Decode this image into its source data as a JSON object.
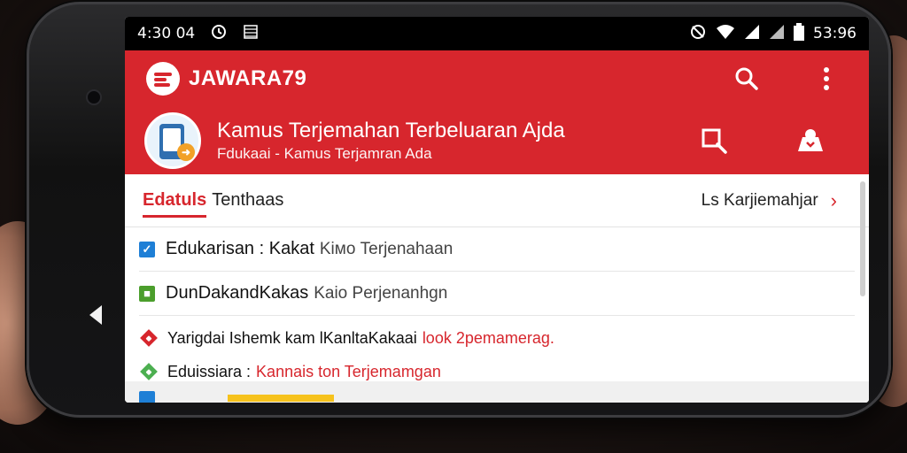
{
  "status_bar": {
    "time_left": "4:30 04",
    "time_right": "53:96",
    "icons": [
      "alarm-icon",
      "notification-icon",
      "dnd-icon",
      "wifi-icon",
      "signal-icon",
      "signal-icon-2",
      "battery-icon"
    ]
  },
  "app_bar": {
    "brand": "JAWARA79",
    "search_icon": "search-icon",
    "menu_icon": "more-vert-icon"
  },
  "header": {
    "title": "Kamus Terjemahan Terbeluaran Ajda",
    "subtitle": "Fdukaai - Kamus Terjamran Ada",
    "action_icons": [
      "search-square-icon",
      "share-icon"
    ]
  },
  "tabs": {
    "active": "Edatuls",
    "other": "Tenthaas",
    "right_link": "Ls Karjiemahjar"
  },
  "list": [
    {
      "type": "checkbox",
      "color": "#1e7fd6",
      "primary": "Edukarisan : Kakat",
      "secondary": "Kiмо  Terjenahaan"
    },
    {
      "type": "checkbox",
      "color": "#4b9e2c",
      "primary": "DunDakandKakas",
      "secondary": "Kaio  Perjenanhgn"
    },
    {
      "type": "diamond",
      "color": "#d7262d",
      "primary": "Yarigdai Ishemk kam lKanltaKakaai",
      "secondary": "look 2pemamerag."
    },
    {
      "type": "diamond",
      "color": "#4caf50",
      "primary": "Eduissiara :",
      "secondary": "Kannais ton Terjemamgan"
    }
  ],
  "colors": {
    "brand_red": "#d7262d",
    "background": "#ffffff"
  }
}
